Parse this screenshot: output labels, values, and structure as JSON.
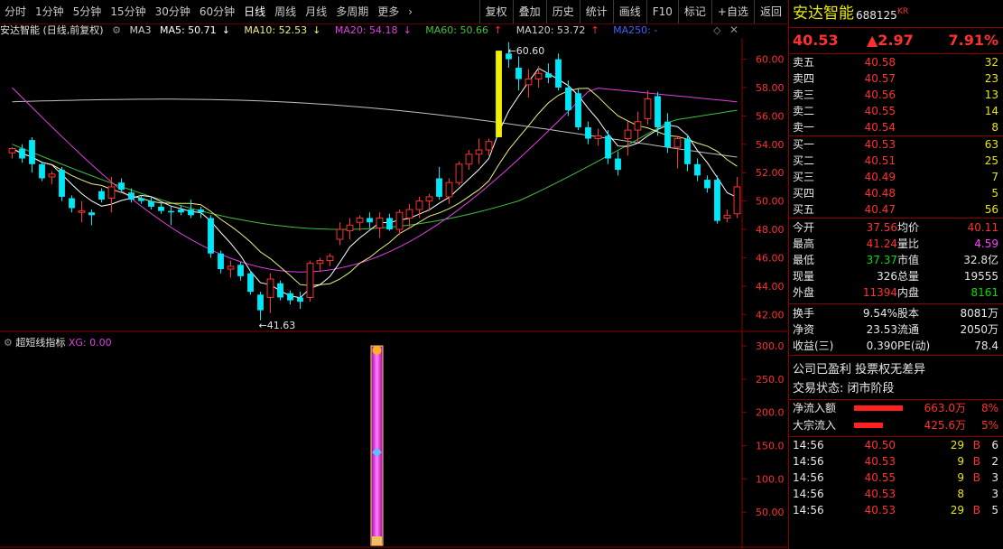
{
  "nav": {
    "left": [
      "分时",
      "1分钟",
      "5分钟",
      "15分钟",
      "30分钟",
      "60分钟",
      "日线",
      "周线",
      "月线",
      "多周期",
      "更多"
    ],
    "more_arrow": "›",
    "active": "日线",
    "right": [
      "复权",
      "叠加",
      "历史",
      "统计",
      "画线",
      "F10",
      "标记",
      "+自选",
      "返回"
    ]
  },
  "legend": {
    "title": "安达智能 (日线,前复权)",
    "ma3": "MA3",
    "ma5": "MA5: 50.71",
    "ma10": "MA10: 52.53",
    "ma20": "MA20: 54.18",
    "ma60": "MA60: 50.66",
    "ma120": "MA120: 53.72",
    "ma250": "MA250: -",
    "arrow_down": "↓",
    "arrow_up": "↑"
  },
  "colors": {
    "up": "#ff3030",
    "down": "#00e8f8",
    "ma5": "#ffffff",
    "ma10": "#f0f080",
    "ma20": "#e040e0",
    "ma60": "#40c040",
    "ma120": "#c0c0c0",
    "limit": "#f0f000"
  },
  "chart_data": {
    "type": "candlestick",
    "y_axis_ticks": [
      "60.00",
      "58.00",
      "56.00",
      "54.00",
      "52.00",
      "50.00",
      "48.00",
      "46.00",
      "44.00",
      "42.00"
    ],
    "ylim": [
      41.0,
      61.5
    ],
    "high_label": "60.60",
    "low_label": "41.63",
    "candles": [
      [
        53.4,
        53.8,
        53.0,
        53.7
      ],
      [
        53.7,
        54.0,
        52.7,
        53.0
      ],
      [
        54.3,
        54.5,
        52.0,
        52.6
      ],
      [
        52.6,
        52.8,
        51.4,
        51.6
      ],
      [
        51.7,
        52.1,
        51.2,
        51.9
      ],
      [
        52.2,
        52.4,
        50.0,
        50.3
      ],
      [
        50.2,
        50.4,
        49.2,
        49.5
      ],
      [
        49.2,
        50.0,
        48.5,
        49.3
      ],
      [
        49.2,
        49.4,
        48.3,
        49.0
      ],
      [
        50.7,
        50.9,
        49.9,
        50.1
      ],
      [
        50.2,
        51.7,
        49.2,
        51.0
      ],
      [
        51.3,
        51.6,
        50.6,
        50.8
      ],
      [
        50.6,
        50.9,
        49.9,
        50.1
      ],
      [
        50.2,
        50.4,
        49.8,
        50.0
      ],
      [
        50.0,
        50.3,
        49.4,
        49.6
      ],
      [
        49.6,
        49.9,
        49.1,
        49.3
      ],
      [
        49.3,
        49.6,
        48.3,
        49.2
      ],
      [
        49.4,
        49.7,
        49.0,
        49.2
      ],
      [
        49.4,
        50.1,
        48.8,
        49.0
      ],
      [
        49.4,
        49.6,
        48.8,
        49.2
      ],
      [
        48.8,
        49.0,
        46.0,
        46.3
      ],
      [
        46.3,
        46.5,
        44.9,
        45.2
      ],
      [
        45.2,
        45.8,
        44.6,
        45.4
      ],
      [
        45.5,
        45.7,
        44.4,
        44.7
      ],
      [
        44.9,
        45.1,
        43.4,
        43.6
      ],
      [
        43.4,
        43.6,
        41.6,
        42.3
      ],
      [
        43.2,
        44.9,
        42.1,
        44.5
      ],
      [
        44.2,
        44.4,
        43.0,
        43.2
      ],
      [
        43.5,
        43.7,
        42.7,
        43.0
      ],
      [
        43.2,
        43.6,
        42.4,
        42.9
      ],
      [
        43.2,
        45.8,
        42.9,
        45.6
      ],
      [
        45.6,
        46.0,
        45.0,
        45.8
      ],
      [
        45.8,
        46.3,
        45.4,
        46.1
      ],
      [
        47.3,
        48.5,
        46.9,
        48.0
      ],
      [
        47.9,
        48.8,
        47.3,
        48.3
      ],
      [
        48.5,
        49.0,
        47.9,
        48.8
      ],
      [
        48.8,
        49.2,
        48.1,
        48.5
      ],
      [
        48.1,
        49.2,
        47.4,
        48.8
      ],
      [
        48.8,
        49.1,
        47.9,
        48.0
      ],
      [
        48.0,
        49.4,
        47.6,
        49.2
      ],
      [
        48.8,
        49.8,
        48.2,
        49.4
      ],
      [
        49.4,
        50.3,
        48.8,
        50.0
      ],
      [
        50.0,
        50.5,
        49.3,
        50.3
      ],
      [
        51.6,
        52.4,
        50.1,
        50.3
      ],
      [
        50.3,
        51.6,
        49.8,
        51.3
      ],
      [
        51.3,
        52.8,
        51.1,
        52.6
      ],
      [
        52.6,
        53.6,
        52.2,
        53.3
      ],
      [
        53.3,
        54.4,
        52.6,
        53.6
      ],
      [
        53.6,
        54.4,
        53.2,
        54.2
      ],
      [
        54.5,
        60.6,
        54.5,
        60.6
      ],
      [
        60.4,
        61.2,
        59.4,
        60.0
      ],
      [
        59.4,
        60.2,
        57.8,
        58.6
      ],
      [
        58.2,
        59.3,
        57.3,
        58.6
      ],
      [
        58.6,
        59.5,
        58.0,
        59.0
      ],
      [
        59.0,
        59.7,
        58.3,
        58.7
      ],
      [
        60.0,
        60.4,
        57.8,
        58.0
      ],
      [
        58.0,
        58.5,
        56.0,
        56.4
      ],
      [
        57.6,
        57.9,
        55.0,
        55.2
      ],
      [
        55.2,
        55.6,
        54.0,
        54.4
      ],
      [
        54.4,
        55.1,
        53.9,
        54.6
      ],
      [
        54.6,
        55.0,
        52.6,
        53.0
      ],
      [
        53.0,
        53.5,
        51.8,
        52.2
      ],
      [
        54.4,
        55.6,
        53.2,
        55.0
      ],
      [
        55.0,
        56.3,
        54.1,
        55.6
      ],
      [
        55.8,
        57.8,
        55.4,
        57.2
      ],
      [
        57.4,
        57.7,
        54.6,
        55.2
      ],
      [
        55.6,
        56.2,
        53.4,
        53.8
      ],
      [
        53.8,
        54.6,
        52.3,
        54.4
      ],
      [
        54.4,
        54.7,
        52.1,
        52.6
      ],
      [
        52.6,
        53.0,
        51.4,
        51.8
      ],
      [
        51.5,
        51.8,
        50.6,
        50.9
      ],
      [
        51.5,
        51.8,
        48.4,
        48.6
      ],
      [
        48.8,
        49.4,
        48.5,
        49.0
      ],
      [
        49.1,
        51.7,
        48.8,
        51.0
      ]
    ],
    "volume_indicator": {
      "name": "超短线指标",
      "param": "XG: 0.00",
      "y_ticks": [
        "300.0",
        "250.0",
        "200.0",
        "150.0",
        "100.0",
        "50.00"
      ],
      "ylim": [
        0,
        315
      ],
      "bar_value": 300,
      "mid_value": 140
    }
  },
  "quote": {
    "name": "安达智能",
    "code": "688125",
    "tag": "KR",
    "price": "40.53",
    "change": "▲2.97",
    "pct": "7.91%",
    "asks": [
      [
        "卖五",
        "40.58",
        "32"
      ],
      [
        "卖四",
        "40.57",
        "23"
      ],
      [
        "卖三",
        "40.56",
        "13"
      ],
      [
        "卖二",
        "40.55",
        "14"
      ],
      [
        "卖一",
        "40.54",
        "8"
      ]
    ],
    "bids": [
      [
        "买一",
        "40.53",
        "63"
      ],
      [
        "买二",
        "40.51",
        "25"
      ],
      [
        "买三",
        "40.49",
        "7"
      ],
      [
        "买四",
        "40.48",
        "5"
      ],
      [
        "买五",
        "40.47",
        "56"
      ]
    ],
    "stats1": [
      [
        "今开",
        "37.56",
        "均价",
        "40.11"
      ],
      [
        "最高",
        "41.24",
        "量比",
        "4.59"
      ],
      [
        "最低",
        "37.37",
        "市值",
        "32.8亿"
      ],
      [
        "现量",
        "326",
        "总量",
        "19555"
      ],
      [
        "外盘",
        "11394",
        "内盘",
        "8161"
      ]
    ],
    "stats2": [
      [
        "换手",
        "9.54%",
        "股本",
        "8081万"
      ],
      [
        "净资",
        "23.53",
        "流通",
        "2050万"
      ],
      [
        "收益(三)",
        "0.390",
        "PE(动)",
        "78.4"
      ]
    ],
    "note1": "公司已盈利 投票权无差异",
    "note2": "交易状态: 闭市阶段",
    "flow": [
      [
        "净流入额",
        "663.0万",
        "8%"
      ],
      [
        "大宗流入",
        "425.6万",
        "5%"
      ]
    ],
    "ticks": [
      [
        "14:56",
        "40.50",
        "29",
        "B",
        "6"
      ],
      [
        "14:56",
        "40.53",
        "9",
        "B",
        "2"
      ],
      [
        "14:56",
        "40.55",
        "9",
        "B",
        "3"
      ],
      [
        "14:56",
        "40.53",
        "8",
        "",
        "3"
      ],
      [
        "14:56",
        "40.53",
        "29",
        "B",
        "5"
      ]
    ]
  }
}
